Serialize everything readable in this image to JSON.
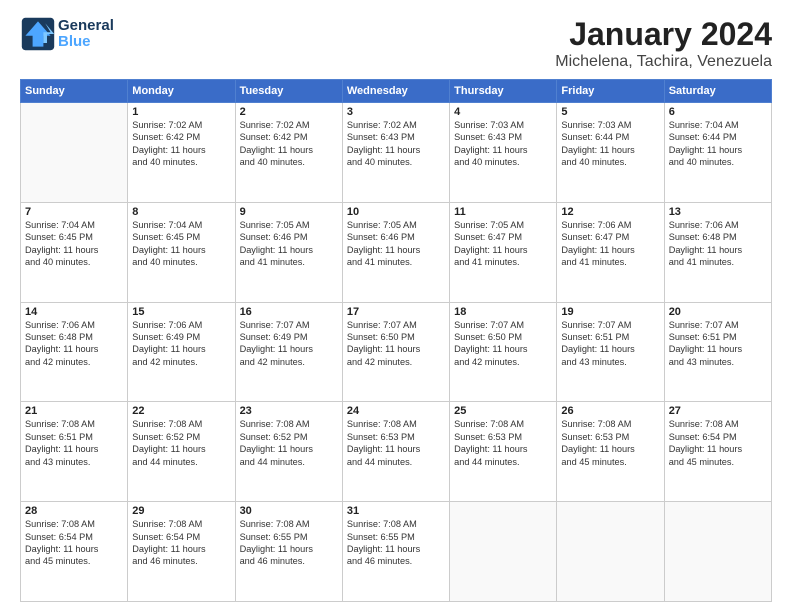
{
  "header": {
    "logo_line1": "General",
    "logo_line2": "Blue",
    "main_title": "January 2024",
    "subtitle": "Michelena, Tachira, Venezuela"
  },
  "days_of_week": [
    "Sunday",
    "Monday",
    "Tuesday",
    "Wednesday",
    "Thursday",
    "Friday",
    "Saturday"
  ],
  "weeks": [
    [
      {
        "day": null
      },
      {
        "day": 1,
        "sunrise": "Sunrise: 7:02 AM",
        "sunset": "Sunset: 6:42 PM",
        "daylight": "Daylight: 11 hours and 40 minutes."
      },
      {
        "day": 2,
        "sunrise": "Sunrise: 7:02 AM",
        "sunset": "Sunset: 6:42 PM",
        "daylight": "Daylight: 11 hours and 40 minutes."
      },
      {
        "day": 3,
        "sunrise": "Sunrise: 7:02 AM",
        "sunset": "Sunset: 6:43 PM",
        "daylight": "Daylight: 11 hours and 40 minutes."
      },
      {
        "day": 4,
        "sunrise": "Sunrise: 7:03 AM",
        "sunset": "Sunset: 6:43 PM",
        "daylight": "Daylight: 11 hours and 40 minutes."
      },
      {
        "day": 5,
        "sunrise": "Sunrise: 7:03 AM",
        "sunset": "Sunset: 6:44 PM",
        "daylight": "Daylight: 11 hours and 40 minutes."
      },
      {
        "day": 6,
        "sunrise": "Sunrise: 7:04 AM",
        "sunset": "Sunset: 6:44 PM",
        "daylight": "Daylight: 11 hours and 40 minutes."
      }
    ],
    [
      {
        "day": 7,
        "sunrise": "Sunrise: 7:04 AM",
        "sunset": "Sunset: 6:45 PM",
        "daylight": "Daylight: 11 hours and 40 minutes."
      },
      {
        "day": 8,
        "sunrise": "Sunrise: 7:04 AM",
        "sunset": "Sunset: 6:45 PM",
        "daylight": "Daylight: 11 hours and 40 minutes."
      },
      {
        "day": 9,
        "sunrise": "Sunrise: 7:05 AM",
        "sunset": "Sunset: 6:46 PM",
        "daylight": "Daylight: 11 hours and 41 minutes."
      },
      {
        "day": 10,
        "sunrise": "Sunrise: 7:05 AM",
        "sunset": "Sunset: 6:46 PM",
        "daylight": "Daylight: 11 hours and 41 minutes."
      },
      {
        "day": 11,
        "sunrise": "Sunrise: 7:05 AM",
        "sunset": "Sunset: 6:47 PM",
        "daylight": "Daylight: 11 hours and 41 minutes."
      },
      {
        "day": 12,
        "sunrise": "Sunrise: 7:06 AM",
        "sunset": "Sunset: 6:47 PM",
        "daylight": "Daylight: 11 hours and 41 minutes."
      },
      {
        "day": 13,
        "sunrise": "Sunrise: 7:06 AM",
        "sunset": "Sunset: 6:48 PM",
        "daylight": "Daylight: 11 hours and 41 minutes."
      }
    ],
    [
      {
        "day": 14,
        "sunrise": "Sunrise: 7:06 AM",
        "sunset": "Sunset: 6:48 PM",
        "daylight": "Daylight: 11 hours and 42 minutes."
      },
      {
        "day": 15,
        "sunrise": "Sunrise: 7:06 AM",
        "sunset": "Sunset: 6:49 PM",
        "daylight": "Daylight: 11 hours and 42 minutes."
      },
      {
        "day": 16,
        "sunrise": "Sunrise: 7:07 AM",
        "sunset": "Sunset: 6:49 PM",
        "daylight": "Daylight: 11 hours and 42 minutes."
      },
      {
        "day": 17,
        "sunrise": "Sunrise: 7:07 AM",
        "sunset": "Sunset: 6:50 PM",
        "daylight": "Daylight: 11 hours and 42 minutes."
      },
      {
        "day": 18,
        "sunrise": "Sunrise: 7:07 AM",
        "sunset": "Sunset: 6:50 PM",
        "daylight": "Daylight: 11 hours and 42 minutes."
      },
      {
        "day": 19,
        "sunrise": "Sunrise: 7:07 AM",
        "sunset": "Sunset: 6:51 PM",
        "daylight": "Daylight: 11 hours and 43 minutes."
      },
      {
        "day": 20,
        "sunrise": "Sunrise: 7:07 AM",
        "sunset": "Sunset: 6:51 PM",
        "daylight": "Daylight: 11 hours and 43 minutes."
      }
    ],
    [
      {
        "day": 21,
        "sunrise": "Sunrise: 7:08 AM",
        "sunset": "Sunset: 6:51 PM",
        "daylight": "Daylight: 11 hours and 43 minutes."
      },
      {
        "day": 22,
        "sunrise": "Sunrise: 7:08 AM",
        "sunset": "Sunset: 6:52 PM",
        "daylight": "Daylight: 11 hours and 44 minutes."
      },
      {
        "day": 23,
        "sunrise": "Sunrise: 7:08 AM",
        "sunset": "Sunset: 6:52 PM",
        "daylight": "Daylight: 11 hours and 44 minutes."
      },
      {
        "day": 24,
        "sunrise": "Sunrise: 7:08 AM",
        "sunset": "Sunset: 6:53 PM",
        "daylight": "Daylight: 11 hours and 44 minutes."
      },
      {
        "day": 25,
        "sunrise": "Sunrise: 7:08 AM",
        "sunset": "Sunset: 6:53 PM",
        "daylight": "Daylight: 11 hours and 44 minutes."
      },
      {
        "day": 26,
        "sunrise": "Sunrise: 7:08 AM",
        "sunset": "Sunset: 6:53 PM",
        "daylight": "Daylight: 11 hours and 45 minutes."
      },
      {
        "day": 27,
        "sunrise": "Sunrise: 7:08 AM",
        "sunset": "Sunset: 6:54 PM",
        "daylight": "Daylight: 11 hours and 45 minutes."
      }
    ],
    [
      {
        "day": 28,
        "sunrise": "Sunrise: 7:08 AM",
        "sunset": "Sunset: 6:54 PM",
        "daylight": "Daylight: 11 hours and 45 minutes."
      },
      {
        "day": 29,
        "sunrise": "Sunrise: 7:08 AM",
        "sunset": "Sunset: 6:54 PM",
        "daylight": "Daylight: 11 hours and 46 minutes."
      },
      {
        "day": 30,
        "sunrise": "Sunrise: 7:08 AM",
        "sunset": "Sunset: 6:55 PM",
        "daylight": "Daylight: 11 hours and 46 minutes."
      },
      {
        "day": 31,
        "sunrise": "Sunrise: 7:08 AM",
        "sunset": "Sunset: 6:55 PM",
        "daylight": "Daylight: 11 hours and 46 minutes."
      },
      {
        "day": null
      },
      {
        "day": null
      },
      {
        "day": null
      }
    ]
  ]
}
